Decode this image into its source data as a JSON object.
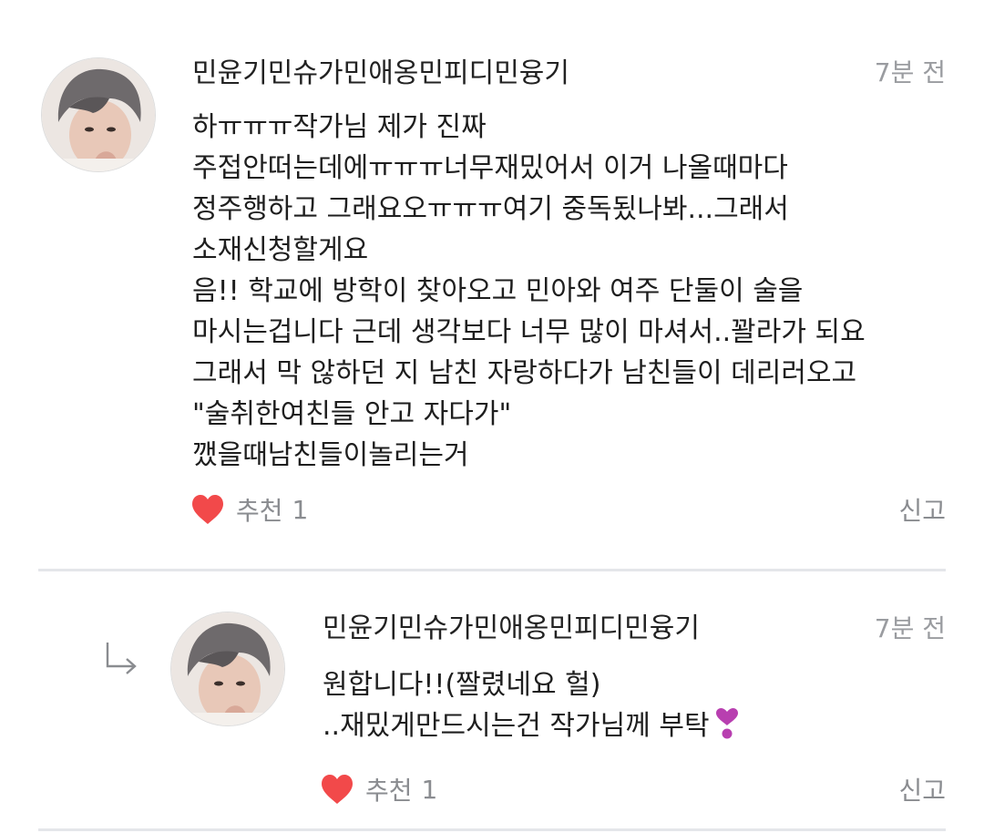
{
  "comments": [
    {
      "author": "민윤기민슈가민애옹민피디민융기",
      "time": "7분 전",
      "lines": [
        "하ㅠㅠㅠ작가님 제가 진짜",
        "주접안떠는데에ㅠㅠㅠ너무재밌어서 이거 나올때마다",
        "정주행하고 그래요오ㅠㅠㅠ여기 중독됬나봐...그래서",
        "소재신청할게요",
        "음!! 학교에 방학이 찾아오고 민아와 여주 단둘이 술을",
        "마시는겁니다 근데 생각보다 너무 많이 마셔서..꽐라가 되요",
        "그래서 막 않하던 지 남친 자랑하다가 남친들이 데리러오고",
        "\"술취한여친들 안고 자다가\"",
        "깼을때남친들이놀리는거"
      ],
      "like_label": "추천",
      "like_count": "1",
      "report_label": "신고"
    },
    {
      "author": "민윤기민슈가민애옹민피디민융기",
      "time": "7분 전",
      "lines": [
        "원합니다!!(짤렸네요 헐)",
        "..재밌게만드시는건 작가님께 부탁"
      ],
      "like_label": "추천",
      "like_count": "1",
      "report_label": "신고"
    }
  ],
  "colors": {
    "heart": "#f2494a",
    "meta": "#8a8c90",
    "time": "#9a9ca0",
    "divider": "#e4e6ea",
    "emoji": "#b83fb0"
  },
  "icons": {
    "like": "heart-icon",
    "reply": "reply-arrow-icon",
    "emoji": "heart-exclamation-emoji"
  }
}
